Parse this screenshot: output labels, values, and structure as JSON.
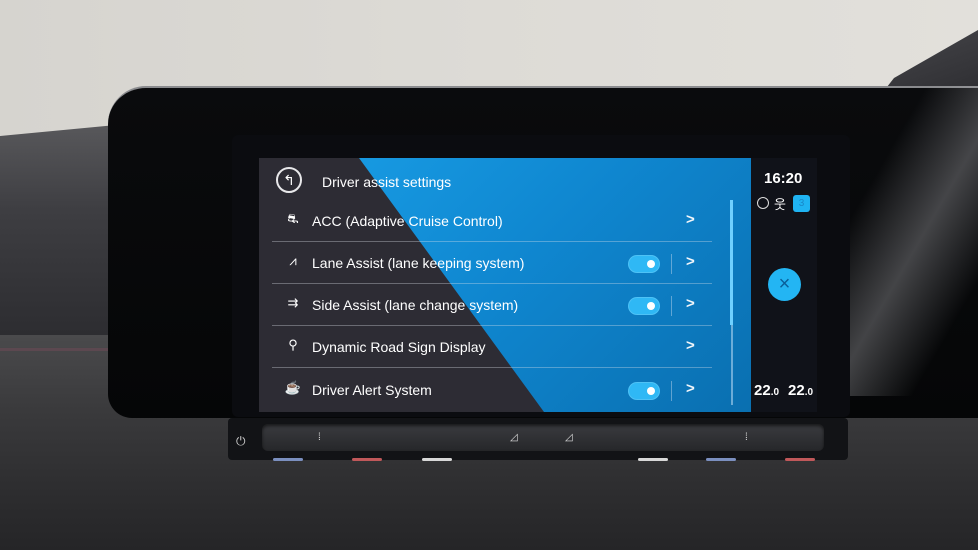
{
  "screen": {
    "title": "Driver assist settings",
    "back_icon": "back-arrow-icon",
    "items": [
      {
        "label": "ACC (Adaptive Cruise Control)",
        "icon": "acc-car-icon",
        "glyph": "⛐",
        "has_toggle": false,
        "toggle_on": null
      },
      {
        "label": "Lane Assist (lane keeping system)",
        "icon": "lane-assist-icon",
        "glyph": "⩘",
        "has_toggle": true,
        "toggle_on": true
      },
      {
        "label": "Side Assist (lane change system)",
        "icon": "side-assist-icon",
        "glyph": "⇉",
        "has_toggle": true,
        "toggle_on": true
      },
      {
        "label": "Dynamic Road Sign Display",
        "icon": "road-sign-icon",
        "glyph": "⚲",
        "has_toggle": false,
        "toggle_on": null
      },
      {
        "label": "Driver Alert System",
        "icon": "coffee-cup-icon",
        "glyph": "☕",
        "has_toggle": true,
        "toggle_on": true
      }
    ],
    "chevron": ">",
    "colors": {
      "accent": "#1aa0e8",
      "toggle": "#2fb8f5",
      "panel_dark": "#2d2c34"
    }
  },
  "status": {
    "time": "16:20",
    "globe_icon": "globe-icon",
    "person_icon": "person-icon",
    "badge": "3",
    "close_symbol": "×",
    "temp_left": {
      "whole": "22",
      "decimal": ".0"
    },
    "temp_right": {
      "whole": "22",
      "decimal": ".0"
    }
  },
  "controls": {
    "power_symbol": "⏻",
    "fan_down": "◿",
    "fan_up": "◿"
  }
}
